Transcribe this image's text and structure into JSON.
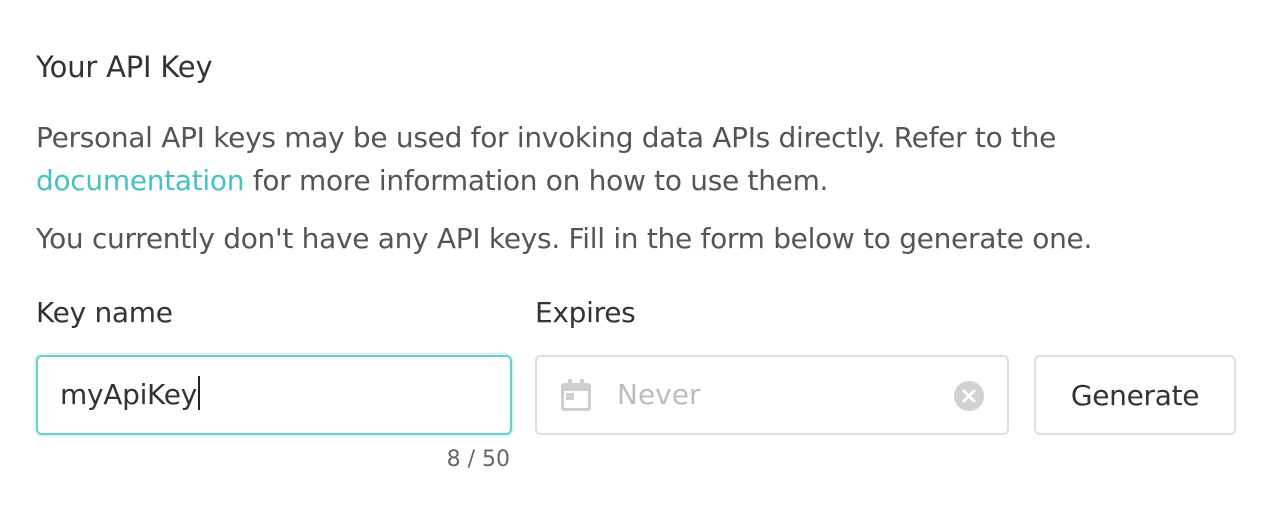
{
  "section": {
    "title": "Your API Key",
    "description_before_link": "Personal API keys may be used for invoking data APIs directly. Refer to the ",
    "link_text": "documentation",
    "description_after_link": " for more information on how to use them.",
    "status_text": "You currently don't have any API keys. Fill in the form below to generate one."
  },
  "form": {
    "key_name_label": "Key name",
    "key_name_value": "myApiKey",
    "key_name_counter": "8 / 50",
    "expires_label": "Expires",
    "expires_placeholder": "Never",
    "generate_label": "Generate"
  },
  "colors": {
    "link": "#48c1c4",
    "focus_border": "#6ccfcf",
    "border": "#dedede",
    "placeholder": "#bdbdbd"
  },
  "icons": {
    "date_field": "calendar-icon",
    "clear": "clear-circle-icon"
  }
}
